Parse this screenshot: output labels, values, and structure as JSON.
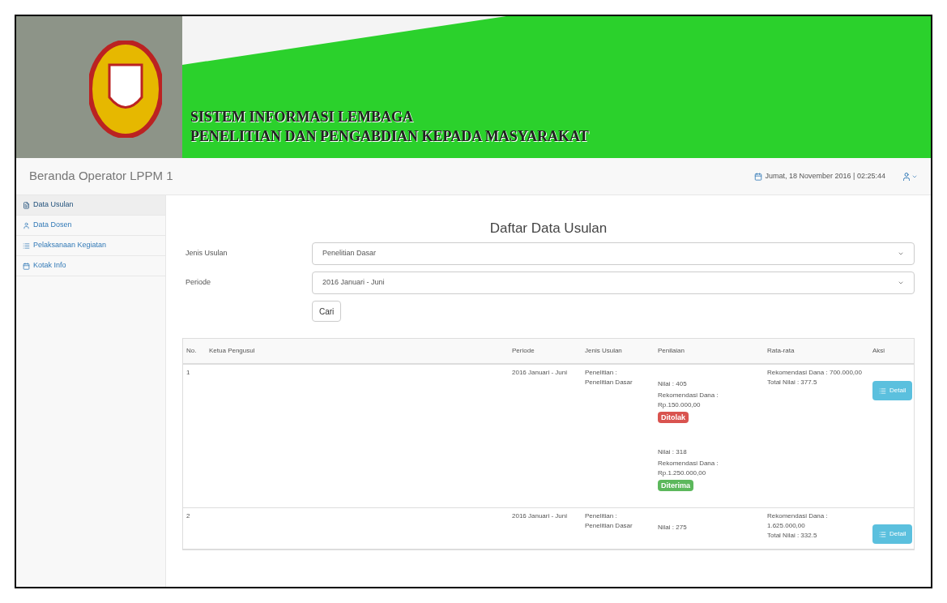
{
  "header": {
    "title_lines": [
      "SISTEM INFORMASI LEMBAGA",
      "PENELITIAN DAN PENGABDIAN KEPADA MASYARAKAT"
    ]
  },
  "navbar": {
    "brand": "Beranda Operator LPPM 1",
    "datetime": "Jumat, 18 November 2016 | 02:25:44"
  },
  "sidebar": {
    "items": [
      {
        "label": "Data Usulan",
        "kind": "file",
        "selected": true
      },
      {
        "label": "Data Dosen",
        "kind": "user",
        "selected": false
      },
      {
        "label": "Pelaksanaan Kegiatan",
        "kind": "list",
        "selected": false
      },
      {
        "label": "Kotak Info",
        "kind": "calendar",
        "selected": false
      }
    ]
  },
  "content": {
    "heading": "Daftar Data Usulan",
    "filters": [
      {
        "label": "Jenis Usulan",
        "value": "Penelitian Dasar"
      },
      {
        "label": "Periode",
        "value": "2016 Januari - Juni"
      }
    ],
    "search_button": "Cari",
    "table": {
      "columns": [
        "No.",
        "Ketua Pengusul",
        "Periode",
        "Jenis Usulan",
        "Penilaian",
        "Rata-rata",
        "Aksi"
      ],
      "rows": [
        {
          "no": "1",
          "periode": "2016 Januari - Juni",
          "jenis": [
            "Penelitian :",
            "Penelitian Dasar"
          ],
          "reviews": [
            {
              "nilai": "Nilai : 405",
              "dana": "Rekomendasi Dana : Rp.150.000,00",
              "status": "Ditolak",
              "kind": "rejected"
            },
            {
              "nilai": "Nilai : 318",
              "dana": "Rekomendasi Dana : Rp.1.250.000,00",
              "status": "Diterima",
              "kind": "accepted"
            }
          ],
          "average": [
            "Rekomendasi Dana : 700.000,00",
            "Total Nilai : 377.5"
          ],
          "action": "Detail"
        },
        {
          "no": "2",
          "periode": "2016 Januari - Juni",
          "jenis": [
            "Penelitian :",
            "Penelitian Dasar"
          ],
          "reviews": [
            {
              "nilai": "Nilai : 275",
              "kind": "partial"
            }
          ],
          "average": [
            "Rekomendasi Dana : 1.625.000,00",
            "Total Nilai : 332.5"
          ],
          "action": "Detail"
        }
      ]
    }
  }
}
